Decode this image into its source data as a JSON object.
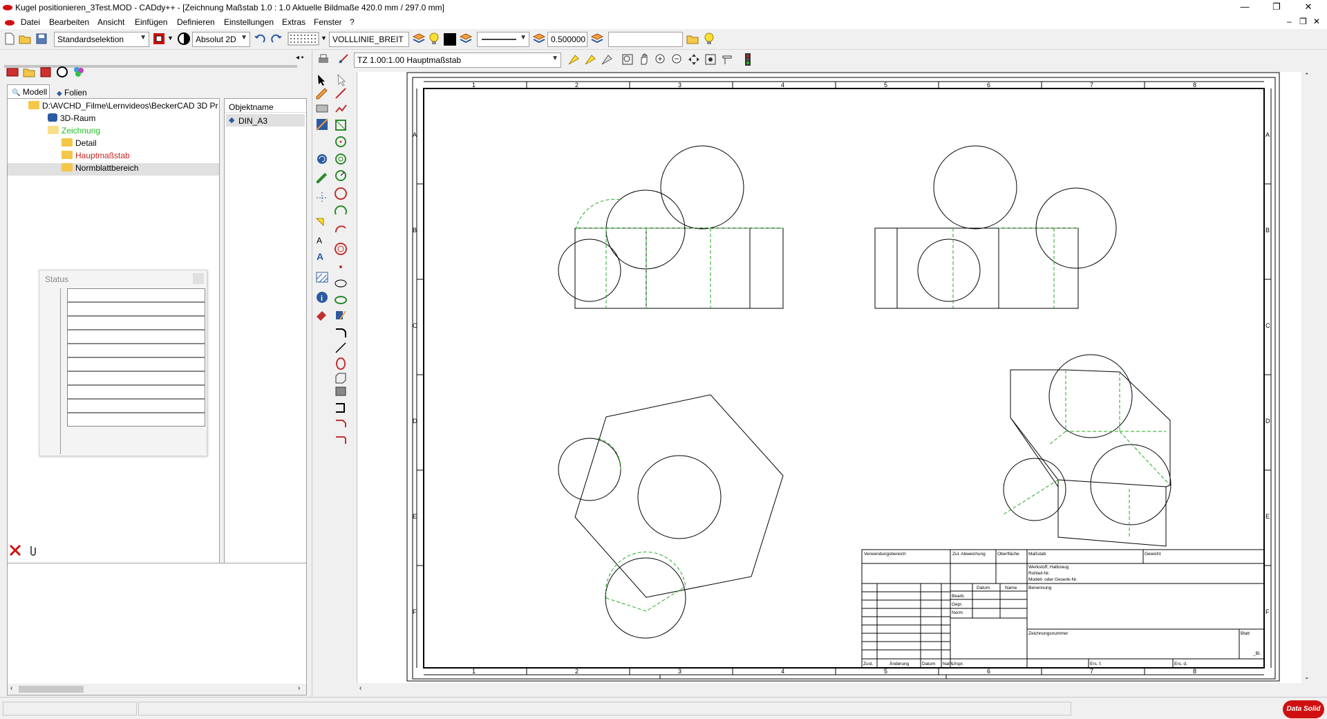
{
  "window": {
    "title": "Kugel positionieren_3Test.MOD  -  CADdy++ - [Zeichnung   Maßstab 1.0 : 1.0   Aktuelle Bildmaße 420.0 mm / 297.0 mm]",
    "minimize": "—",
    "restore": "❐",
    "close": "✕",
    "doc_minimize": "–",
    "doc_restore": "❐",
    "doc_close": "✕"
  },
  "menu": [
    "Datei",
    "Bearbeiten",
    "Ansicht",
    "Einfügen",
    "Definieren",
    "Einstellungen",
    "Extras",
    "Fenster",
    "?"
  ],
  "toolbar": {
    "selection_mode": "Standardselektion",
    "coord_mode": "Absolut 2D",
    "line_type": "VOLLLINIE_BREIT",
    "line_width": "0.500000",
    "extra_input": ""
  },
  "view_toolbar": {
    "scale_combo": "TZ 1.00:1.00 Hauptmaßstab"
  },
  "left_tabs": [
    "Modell",
    "Folien"
  ],
  "tree": {
    "root": "D:\\AVCHD_Filme\\Lernvideos\\BeckerCAD 3D Pr",
    "items": [
      {
        "label": "3D-Raum",
        "color": "#000000"
      },
      {
        "label": "Zeichnung",
        "color": "#22bb22"
      },
      {
        "label": "Detail",
        "color": "#000000"
      },
      {
        "label": "Hauptmaßstab",
        "color": "#cc2222"
      },
      {
        "label": "Normblattbereich",
        "color": "#000000"
      }
    ]
  },
  "object_list": {
    "header": "Objektname",
    "items": [
      "DIN_A3"
    ]
  },
  "status_panel": {
    "title": "Status"
  },
  "drawing": {
    "columns": [
      "1",
      "2",
      "3",
      "4",
      "5",
      "6",
      "7",
      "8"
    ],
    "rows": [
      "A",
      "B",
      "C",
      "D",
      "E",
      "F"
    ],
    "title_block": {
      "verwendungsbereich": "Verwendungsbereich",
      "zul_abweichung": "Zul. Abweichung",
      "oberflaeche": "Oberfläche",
      "massstab": "Maßstab",
      "gewicht": "Gewicht",
      "werkstoff": "Werkstoff, Halbzeug",
      "rohteil": "Rohteil-Nr.",
      "modell": "Modell- oder Gesenk-Nr.",
      "datum": "Datum",
      "name": "Name",
      "benennung": "Benennung",
      "bearb": "Bearb.",
      "gepr": "Gepr.",
      "norm": "Norm",
      "zeichnungsnummer": "Zeichnungsnummer",
      "blatt": "Blatt",
      "bl": "_Bl.",
      "zust": "Zust.",
      "aenderung": "Änderung",
      "datum2": "Datum",
      "nam": "Nam.",
      "urspr": "Urspr.",
      "ers_f": "Ers. f.",
      "ers_d": "Ers. d."
    }
  },
  "brand": "Data Solid"
}
